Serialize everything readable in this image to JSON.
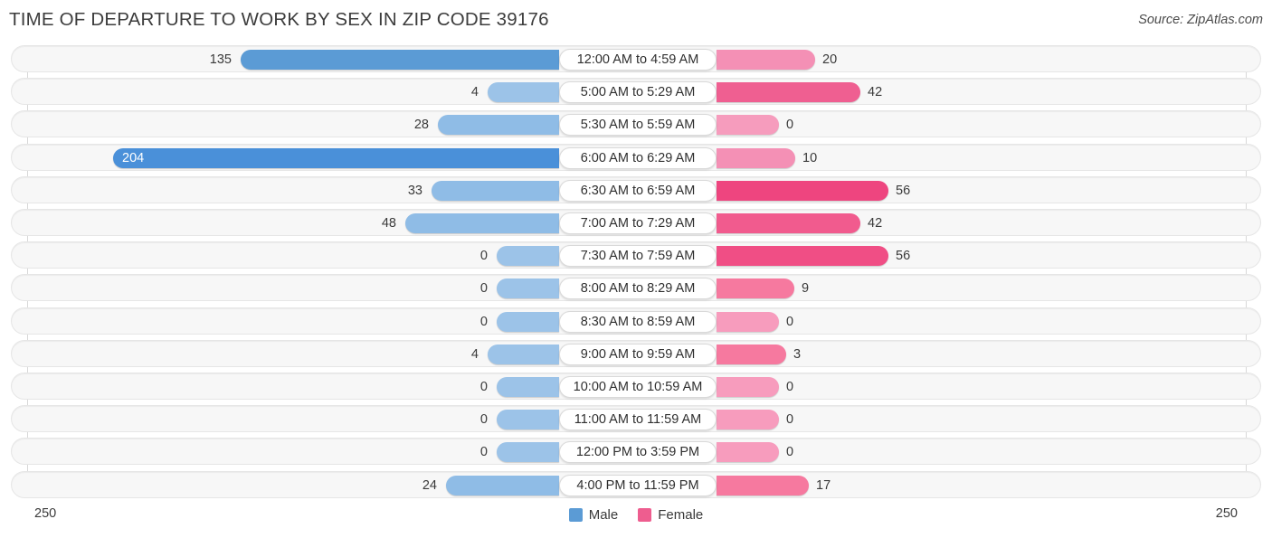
{
  "header": {
    "title": "TIME OF DEPARTURE TO WORK BY SEX IN ZIP CODE 39176",
    "source": "Source: ZipAtlas.com"
  },
  "legend": {
    "male": {
      "label": "Male",
      "color": "#5b9bd5"
    },
    "female": {
      "label": "Female",
      "color": "#ee5d8f"
    }
  },
  "axis": {
    "left_max": "250",
    "right_max": "250"
  },
  "chart_data": {
    "type": "bar",
    "title": "TIME OF DEPARTURE TO WORK BY SEX IN ZIP CODE 39176",
    "subtitle": "Source: ZipAtlas.com",
    "orientation": "horizontal-diverging",
    "xlabel": "",
    "ylabel": "",
    "xlim": [
      250,
      250
    ],
    "grid": false,
    "legend_position": "bottom-center",
    "categories": [
      "12:00 AM to 4:59 AM",
      "5:00 AM to 5:29 AM",
      "5:30 AM to 5:59 AM",
      "6:00 AM to 6:29 AM",
      "6:30 AM to 6:59 AM",
      "7:00 AM to 7:29 AM",
      "7:30 AM to 7:59 AM",
      "8:00 AM to 8:29 AM",
      "8:30 AM to 8:59 AM",
      "9:00 AM to 9:59 AM",
      "10:00 AM to 10:59 AM",
      "11:00 AM to 11:59 AM",
      "12:00 PM to 3:59 PM",
      "4:00 PM to 11:59 PM"
    ],
    "series": [
      {
        "name": "Male",
        "values": [
          135,
          4,
          28,
          204,
          33,
          48,
          0,
          0,
          0,
          4,
          0,
          0,
          0,
          24
        ]
      },
      {
        "name": "Female",
        "values": [
          20,
          42,
          0,
          10,
          56,
          42,
          56,
          9,
          0,
          3,
          0,
          0,
          0,
          17
        ]
      }
    ]
  },
  "rows": [
    {
      "label": "12:00 AM to 4:59 AM",
      "male": "135",
      "female": "20",
      "male_w": 352,
      "female_w": 109,
      "male_color": "#5b9bd5",
      "female_color": "#f490b5",
      "male_inside": false
    },
    {
      "label": "5:00 AM to 5:29 AM",
      "male": "4",
      "female": "42",
      "male_w": 79,
      "female_w": 159,
      "male_color": "#9cc3e8",
      "female_color": "#ef5f91",
      "male_inside": false
    },
    {
      "label": "5:30 AM to 5:59 AM",
      "male": "28",
      "female": "0",
      "male_w": 134,
      "female_w": 69,
      "male_color": "#8fbce6",
      "female_color": "#f69cbd",
      "male_inside": false
    },
    {
      "label": "6:00 AM to 6:29 AM",
      "male": "204",
      "female": "10",
      "male_w": 493,
      "female_w": 87,
      "male_color": "#4a90d9",
      "female_color": "#f490b5",
      "male_inside": true
    },
    {
      "label": "6:30 AM to 6:59 AM",
      "male": "33",
      "female": "56",
      "male_w": 141,
      "female_w": 190,
      "male_color": "#8fbce6",
      "female_color": "#ee457f",
      "male_inside": false
    },
    {
      "label": "7:00 AM to 7:29 AM",
      "male": "48",
      "female": "42",
      "male_w": 170,
      "female_w": 159,
      "male_color": "#8fbce6",
      "female_color": "#f15b8e",
      "male_inside": false
    },
    {
      "label": "7:30 AM to 7:59 AM",
      "male": "0",
      "female": "56",
      "male_w": 69,
      "female_w": 190,
      "male_color": "#9cc3e8",
      "female_color": "#f04e85",
      "male_inside": false
    },
    {
      "label": "8:00 AM to 8:29 AM",
      "male": "0",
      "female": "9",
      "male_w": 69,
      "female_w": 86,
      "male_color": "#9cc3e8",
      "female_color": "#f6799f",
      "male_inside": false
    },
    {
      "label": "8:30 AM to 8:59 AM",
      "male": "0",
      "female": "0",
      "male_w": 69,
      "female_w": 69,
      "male_color": "#9cc3e8",
      "female_color": "#f79cbd",
      "male_inside": false
    },
    {
      "label": "9:00 AM to 9:59 AM",
      "male": "4",
      "female": "3",
      "male_w": 79,
      "female_w": 77,
      "male_color": "#9cc3e8",
      "female_color": "#f6799f",
      "male_inside": false
    },
    {
      "label": "10:00 AM to 10:59 AM",
      "male": "0",
      "female": "0",
      "male_w": 69,
      "female_w": 69,
      "male_color": "#9cc3e8",
      "female_color": "#f79cbd",
      "male_inside": false
    },
    {
      "label": "11:00 AM to 11:59 AM",
      "male": "0",
      "female": "0",
      "male_w": 69,
      "female_w": 69,
      "male_color": "#9cc3e8",
      "female_color": "#f79cbd",
      "male_inside": false
    },
    {
      "label": "12:00 PM to 3:59 PM",
      "male": "0",
      "female": "0",
      "male_w": 69,
      "female_w": 69,
      "male_color": "#9cc3e8",
      "female_color": "#f79cbd",
      "male_inside": false
    },
    {
      "label": "4:00 PM to 11:59 PM",
      "male": "24",
      "female": "17",
      "male_w": 125,
      "female_w": 102,
      "male_color": "#8fbce6",
      "female_color": "#f6799f",
      "male_inside": false
    }
  ]
}
